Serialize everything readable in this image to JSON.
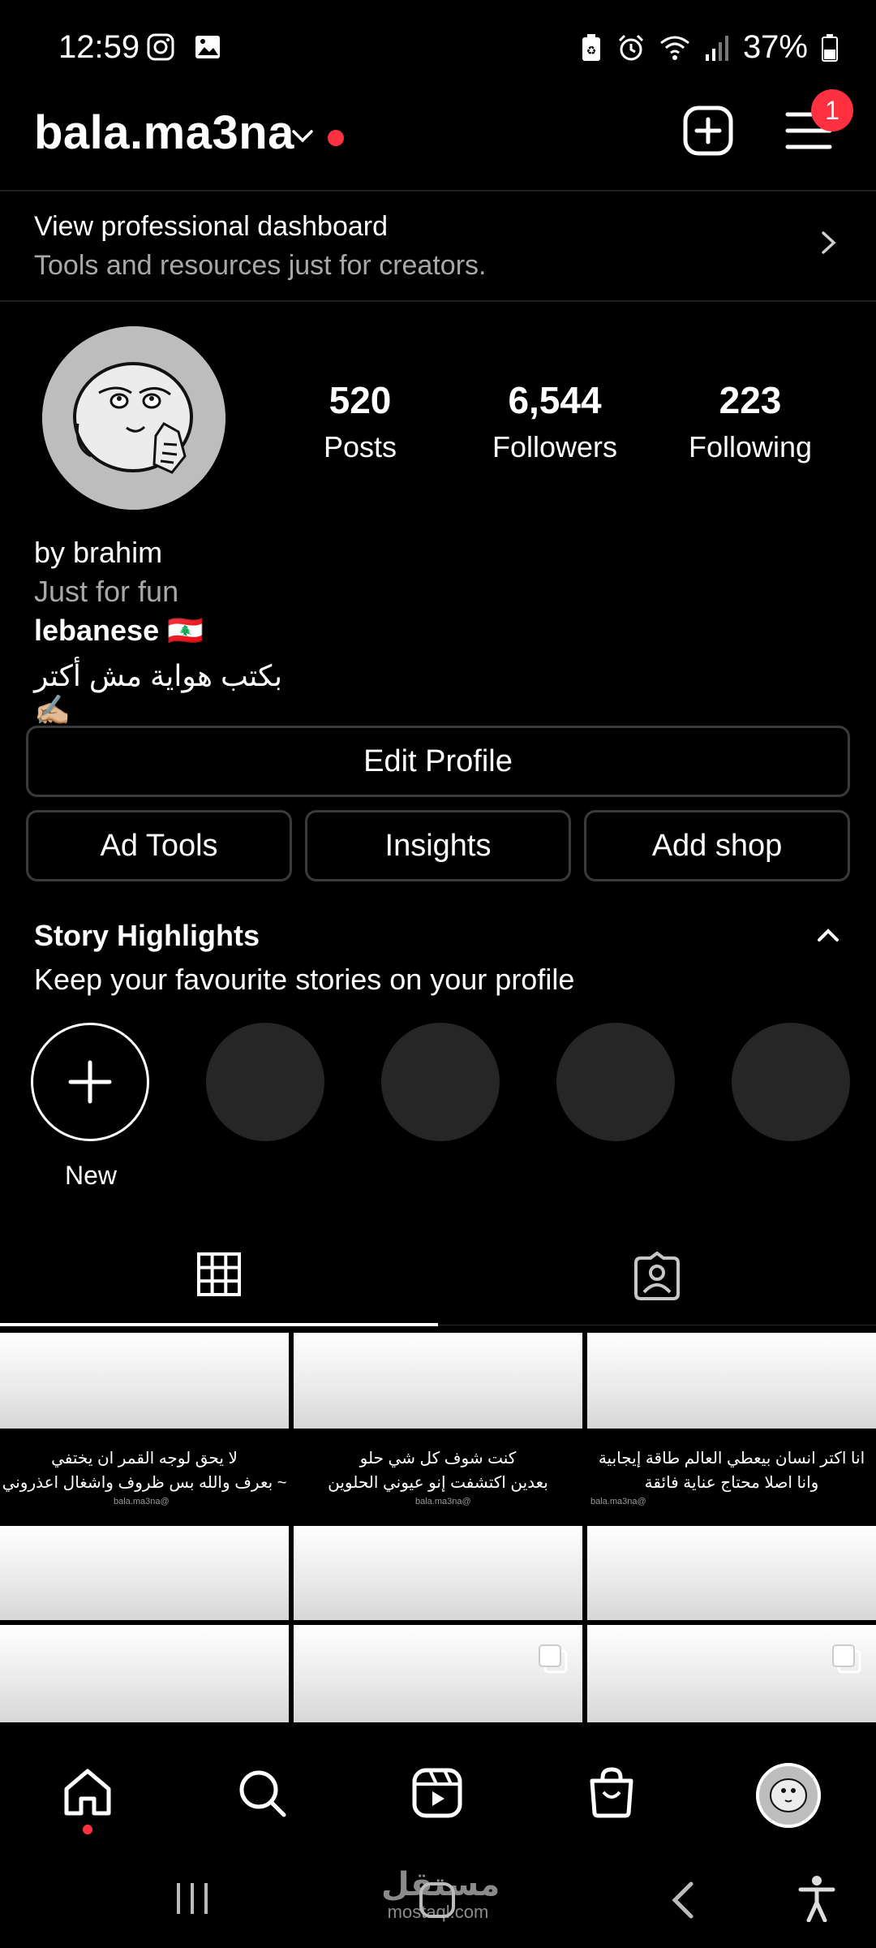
{
  "status_bar": {
    "time": "12:59",
    "battery": "37%"
  },
  "header": {
    "username": "bala.ma3na",
    "badge_count": "1"
  },
  "dashboard": {
    "title": "View professional dashboard",
    "subtitle": "Tools and resources just for creators."
  },
  "stats": [
    {
      "value": "520",
      "label": "Posts"
    },
    {
      "value": "6,544",
      "label": "Followers"
    },
    {
      "value": "223",
      "label": "Following"
    }
  ],
  "bio": {
    "name": "by brahim",
    "line2": "Just for fun",
    "line3": "lebanese 🇱🇧",
    "line4": "بكتب هواية مش أكتر ✍🏼"
  },
  "buttons": {
    "edit_profile": "Edit Profile",
    "ad_tools": "Ad Tools",
    "insights": "Insights",
    "add_shop": "Add shop"
  },
  "highlights": {
    "title": "Story Highlights",
    "subtitle": "Keep your favourite stories on your profile",
    "new_label": "New"
  },
  "posts": [
    {
      "line1": "لا يحق لوجه القمر ان يختفي",
      "line2": "~ بعرف والله بس ظروف واشغال اعذروني",
      "tag": "@bala.ma3na"
    },
    {
      "line1": "كنت شوف كل شي حلو",
      "line2": "بعدين اكتشفت إنو عيوني الحلوين",
      "tag": "@bala.ma3na"
    },
    {
      "line1": "انا اكتر انسان بيعطي العالم طاقة إيجابية",
      "line2": "وانا اصلا محتاج عناية فائقة",
      "tag": "@bala.ma3na"
    }
  ],
  "watermark": {
    "arabic": "مستقل",
    "latin": "mostaql.com"
  },
  "colors": {
    "accent_red": "#ff3040",
    "background": "#000000",
    "button_border": "#3a3a3a"
  }
}
